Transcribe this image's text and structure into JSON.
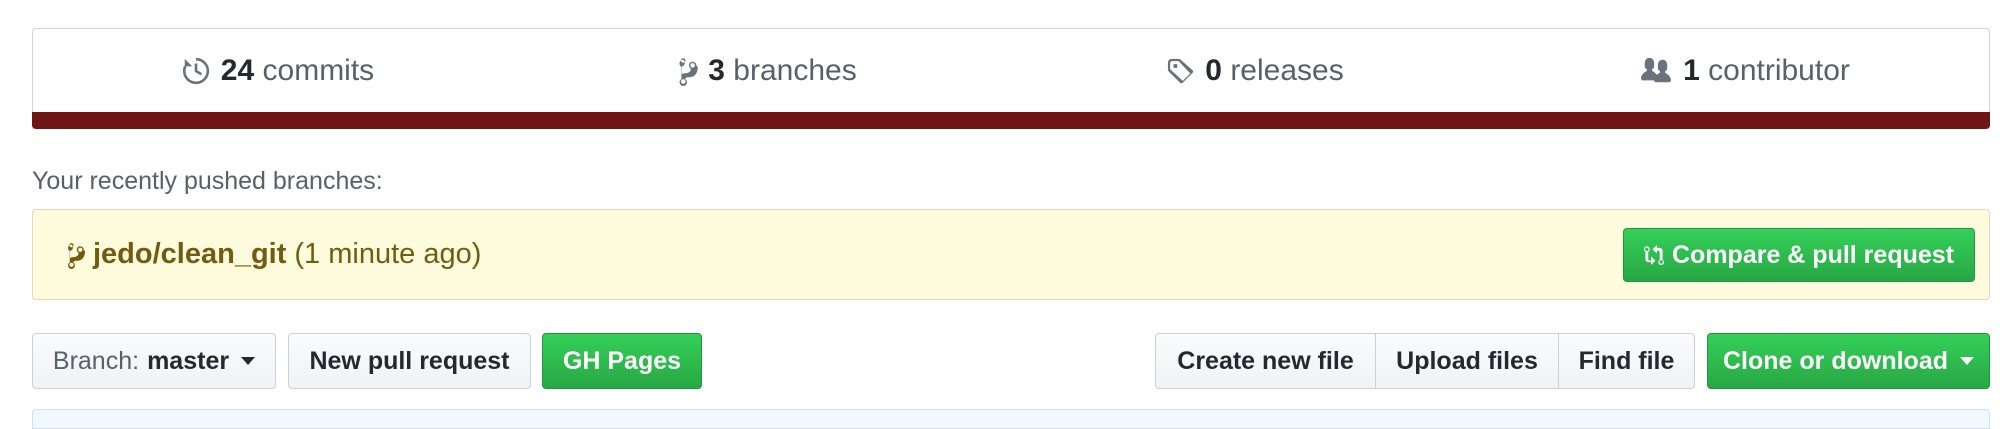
{
  "summary": {
    "commits": {
      "count": "24",
      "label": "commits",
      "icon": "history-icon"
    },
    "branches": {
      "count": "3",
      "label": "branches",
      "icon": "branch-icon"
    },
    "releases": {
      "count": "0",
      "label": "releases",
      "icon": "tag-icon"
    },
    "contributors": {
      "count": "1",
      "label": "contributor",
      "icon": "people-icon"
    },
    "language_color": "#701516"
  },
  "recent": {
    "label": "Your recently pushed branches:",
    "branch_name": "jedo/clean_git",
    "time": "(1 minute ago)",
    "compare_label": "Compare & pull request"
  },
  "toolbar": {
    "branch_prefix": "Branch:",
    "branch_value": "master",
    "new_pr_label": "New pull request",
    "gh_pages_label": "GH Pages",
    "create_file_label": "Create new file",
    "upload_label": "Upload files",
    "find_label": "Find file",
    "clone_label": "Clone or download"
  },
  "colors": {
    "green": "#28a745",
    "notice_bg": "#fffbdd",
    "notice_text": "#735c0f"
  }
}
